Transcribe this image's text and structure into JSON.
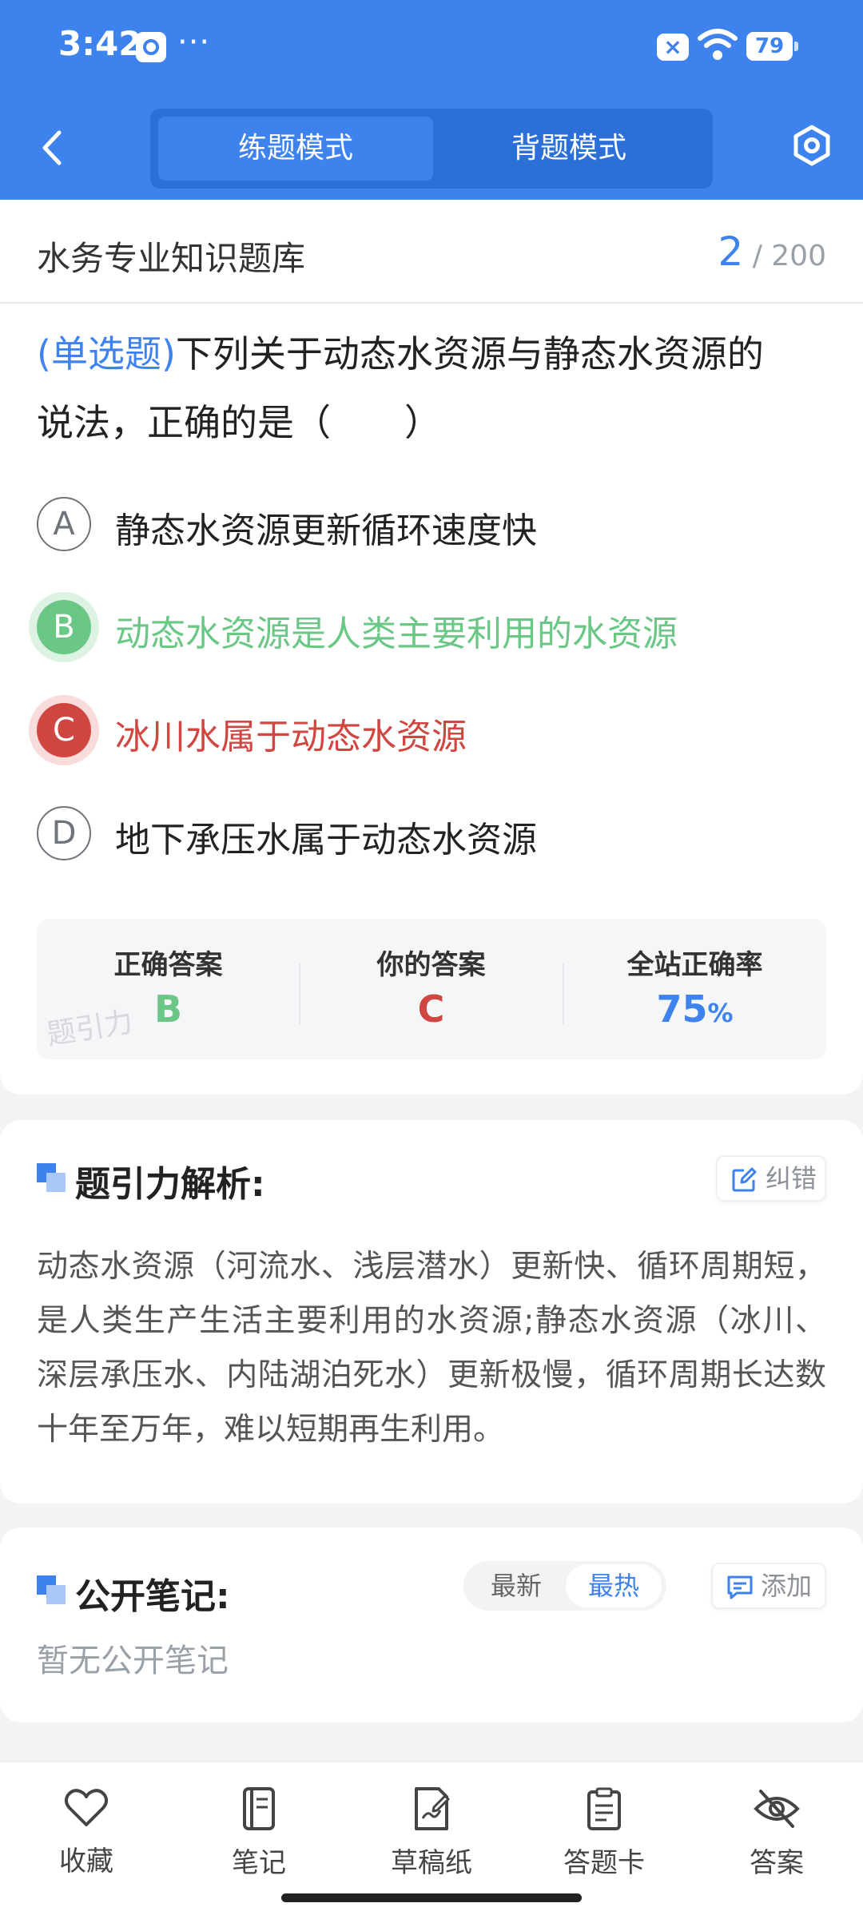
{
  "status_bar": {
    "time": "3:42",
    "overflow": "···",
    "battery": "79"
  },
  "header": {
    "tabs": [
      {
        "label": "练题模式",
        "active": true
      },
      {
        "label": "背题模式",
        "active": false
      }
    ]
  },
  "question_header": {
    "bank_title": "水务专业知识题库",
    "current": "2",
    "total": "/ 200"
  },
  "question": {
    "type": "(单选题)",
    "line1": "下列关于动态水资源与静态水资源的",
    "line2": "说法，正确的是（　　）"
  },
  "options": [
    {
      "letter": "A",
      "text": "静态水资源更新循环速度快",
      "state": "normal"
    },
    {
      "letter": "B",
      "text": "动态水资源是人类主要利用的水资源",
      "state": "correct"
    },
    {
      "letter": "C",
      "text": "冰川水属于动态水资源",
      "state": "wrong"
    },
    {
      "letter": "D",
      "text": "地下承压水属于动态水资源",
      "state": "normal"
    }
  ],
  "result": {
    "correct_label": "正确答案",
    "correct_value": "B",
    "yours_label": "你的答案",
    "yours_value": "C",
    "rate_label": "全站正确率",
    "rate_value": "75",
    "rate_unit": "%",
    "watermark": "题引力"
  },
  "analysis": {
    "title": "题引力解析:",
    "report_label": "纠错",
    "text": "动态水资源（河流水、浅层潜水）更新快、循环周期短，是人类生产生活主要利用的水资源;静态水资源（冰川、深层承压水、内陆湖泊死水）更新极慢，循环周期长达数十年至万年，难以短期再生利用。"
  },
  "notes": {
    "title": "公开笔记:",
    "sort_tabs": [
      {
        "label": "最新",
        "active": false
      },
      {
        "label": "最热",
        "active": true
      }
    ],
    "add_label": "添加",
    "empty_text": "暂无公开笔记"
  },
  "bottom_bar": [
    {
      "label": "收藏",
      "icon": "heart-icon"
    },
    {
      "label": "笔记",
      "icon": "notebook-icon"
    },
    {
      "label": "草稿纸",
      "icon": "draft-icon"
    },
    {
      "label": "答题卡",
      "icon": "answer-sheet-icon"
    },
    {
      "label": "答案",
      "icon": "eye-off-icon"
    }
  ],
  "colors": {
    "primary": "#3e82ee",
    "correct": "#6bc785",
    "wrong": "#cf4740"
  }
}
